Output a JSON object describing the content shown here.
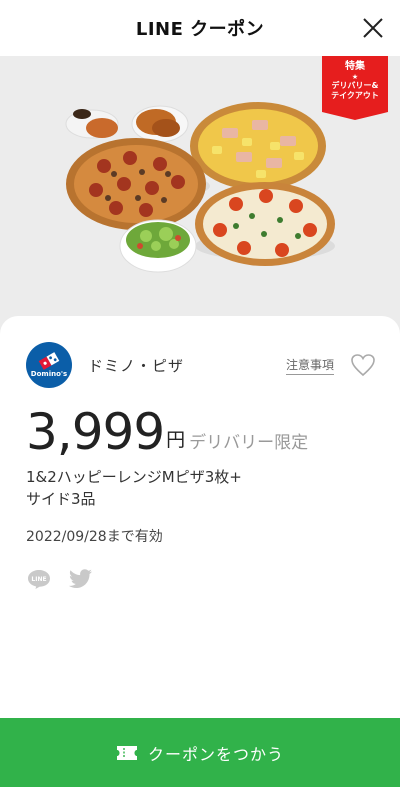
{
  "header": {
    "title": "LINE クーポン"
  },
  "hero": {
    "badge": {
      "title": "特集",
      "star": "★",
      "line1": "デリバリー&",
      "line2": "テイクアウト"
    }
  },
  "brand": {
    "name": "ドミノ・ピザ",
    "logo_text": "Domino's",
    "notes_label": "注意事項"
  },
  "offer": {
    "price": "3,999",
    "unit": "円",
    "note": "デリバリー限定",
    "description_line1": "1&2ハッピーレンジMピザ3枚+",
    "description_line2": "サイド3品",
    "expiry": "2022/09/28まで有効"
  },
  "action": {
    "use_label": "クーポンをつかう"
  },
  "colors": {
    "accent_green": "#31b24a",
    "badge_red": "#e61e1e",
    "brand_blue": "#0b5ea8"
  }
}
